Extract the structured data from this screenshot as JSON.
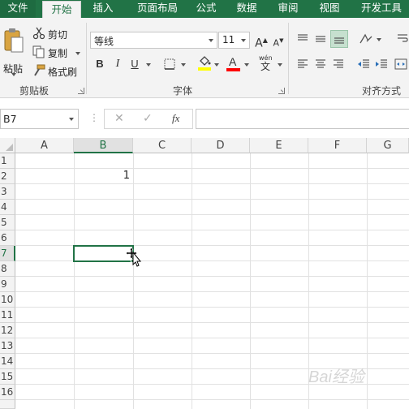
{
  "tabs": [
    {
      "label": "文件"
    },
    {
      "label": "开始"
    },
    {
      "label": "插入"
    },
    {
      "label": "页面布局"
    },
    {
      "label": "公式"
    },
    {
      "label": "数据"
    },
    {
      "label": "审阅"
    },
    {
      "label": "视图"
    },
    {
      "label": "开发工具"
    }
  ],
  "clipboard": {
    "paste": "粘贴",
    "cut": "剪切",
    "copy": "复制",
    "format_painter": "格式刷",
    "group": "剪贴板"
  },
  "font": {
    "name": "等线",
    "size": "11",
    "bold": "B",
    "italic": "I",
    "underline": "U",
    "grow": "A",
    "shrink": "A",
    "phonetic": "wén",
    "phonetic_char": "文",
    "fill_color": "#ffff00",
    "font_color": "#ff0000",
    "group": "字体"
  },
  "alignment": {
    "group": "对齐方式"
  },
  "formula_bar": {
    "name_box": "B7",
    "cancel": "✕",
    "enter": "✓",
    "fx": "fx",
    "content": ""
  },
  "columns": [
    "A",
    "B",
    "C",
    "D",
    "E",
    "F",
    "G"
  ],
  "rows": [
    "1",
    "2",
    "3",
    "4",
    "5",
    "6",
    "7",
    "8",
    "9",
    "10",
    "11",
    "12",
    "13",
    "14",
    "15",
    "16"
  ],
  "cells": {
    "B2": "1"
  },
  "selected": {
    "column": "B",
    "row": "7"
  },
  "watermark": "Bai经验",
  "colors": {
    "accent": "#217346"
  }
}
